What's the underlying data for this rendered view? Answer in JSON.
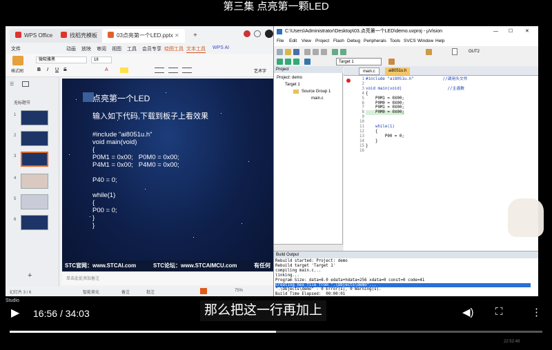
{
  "video_title": "第三集 点亮第一颗LED",
  "subtitle": "那么把这一行再加上",
  "player": {
    "current_time": "16:56",
    "separator": "/",
    "total_time": "34:03",
    "studio_label": "Studio",
    "progress": 0.5
  },
  "wps": {
    "tabs": [
      "WPS Office",
      "找稻壳模板",
      "03点亮第一个LED.pptx"
    ],
    "menu": [
      "文件",
      "动画",
      "放映",
      "审阅",
      "视图",
      "工具",
      "会员专享",
      "绘图工具",
      "文本工具",
      "WPS AI"
    ],
    "font_name": "微软雅黑",
    "font_size": "18",
    "format_painter": "格式刷",
    "art_label": "艺术字",
    "section_label": "无标题节",
    "slide_numbers": [
      "1",
      "2",
      "3",
      "4",
      "5",
      "6"
    ],
    "slide": {
      "title": "点亮第一个LED",
      "subtitle": "输入如下代码,下载到板子上看效果",
      "code": [
        "#include \"ai8051u.h\"",
        "void main(void)",
        "{",
        "P0M1 = 0x00;   P0M0 = 0x00;",
        "P4M1 = 0x00;   P4M0 = 0x00;",
        "",
        "P40 = 0;",
        "",
        "while(1)",
        "{",
        "P00 = 0;",
        "}",
        "}"
      ],
      "footer_left": "STC官网：www.STCAI.com",
      "footer_mid": "STC论坛：www.STCAIMCU.com",
      "footer_right": "有任何疑"
    },
    "notes_placeholder": "单击此处添加备注",
    "status_slide": "幻灯片 3 / 6",
    "status_beautify": "智能美化",
    "status_notes": "备注",
    "status_comment": "批注",
    "zoom": "75%"
  },
  "uvision": {
    "title": "C:\\Users\\Administrator\\Desktop\\03.点亮第一个LED\\demo.uvproj - µVision",
    "menu": [
      "File",
      "Edit",
      "View",
      "Project",
      "Flash",
      "Debug",
      "Peripherals",
      "Tools",
      "SVCS",
      "Window",
      "Help"
    ],
    "target_select": "Target 1",
    "out_label": "OUT2",
    "project_header": "Project",
    "tree": [
      "Project: demo",
      "Target 1",
      "Source Group 1",
      "main.c"
    ],
    "editor_tabs": [
      "main.c",
      "ai8051u.h"
    ],
    "code_lines": [
      {
        "n": "1",
        "t": "#include \"ai8051u.h\"            //调用头文件"
      },
      {
        "n": "2",
        "t": ""
      },
      {
        "n": "3",
        "t": "void main(void)                   //主函数"
      },
      {
        "n": "4",
        "t": "{"
      },
      {
        "n": "5",
        "t": "    P0M1 = 0X00;"
      },
      {
        "n": "6",
        "t": "    P0M0 = 0X00;"
      },
      {
        "n": "7",
        "t": "    P0M1 = 0X00;"
      },
      {
        "n": "8",
        "t": "    P0M0 = 0X00;"
      },
      {
        "n": "9",
        "t": ""
      },
      {
        "n": "10",
        "t": ""
      },
      {
        "n": "11",
        "t": "    while(1)"
      },
      {
        "n": "12",
        "t": "    {"
      },
      {
        "n": "13",
        "t": "        P00 = 0;"
      },
      {
        "n": "14",
        "t": "    }"
      },
      {
        "n": "15",
        "t": "}"
      },
      {
        "n": "16",
        "t": ""
      }
    ],
    "build_header": "Build Output",
    "build_lines": [
      "Rebuild started: Project: demo",
      "Rebuild target 'Target 1'",
      "compiling main.c...",
      "linking...",
      "Program Size: data=8.0 edata+hdata=256 xdata=0 const=0 code=41",
      "creating hex file from \".\\Objects\\demo\"...",
      "\".\\Objects\\demo\" - 0 Error(s), 0 Warning(s).",
      "Build Time Elapsed:  00:00:01"
    ]
  },
  "taskbar_time": "22:52:48"
}
